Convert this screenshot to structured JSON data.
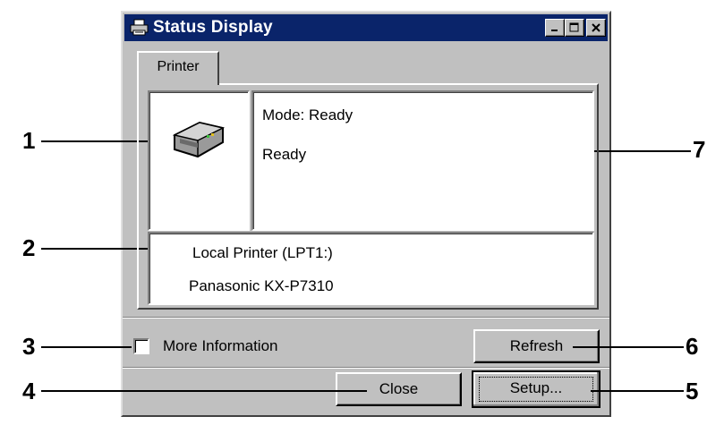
{
  "window": {
    "title": "Status Display",
    "controls": [
      "minimize-icon",
      "maximize-icon",
      "close-icon"
    ]
  },
  "tabs": [
    {
      "label": "Printer",
      "active": true
    }
  ],
  "status": {
    "printer_icon": "printer-icon",
    "mode_line": "Mode: Ready",
    "status_line": "Ready"
  },
  "printer_info": {
    "port": "Local Printer (LPT1:)",
    "model": "Panasonic KX-P7310"
  },
  "more_info": {
    "label": "More Information",
    "checked": false
  },
  "buttons": {
    "refresh": "Refresh",
    "close": "Close",
    "setup": "Setup..."
  },
  "callouts": [
    "1",
    "2",
    "3",
    "4",
    "5",
    "6",
    "7"
  ],
  "colors": {
    "titlebar": "#0a246a",
    "face": "#c0c0c0"
  }
}
